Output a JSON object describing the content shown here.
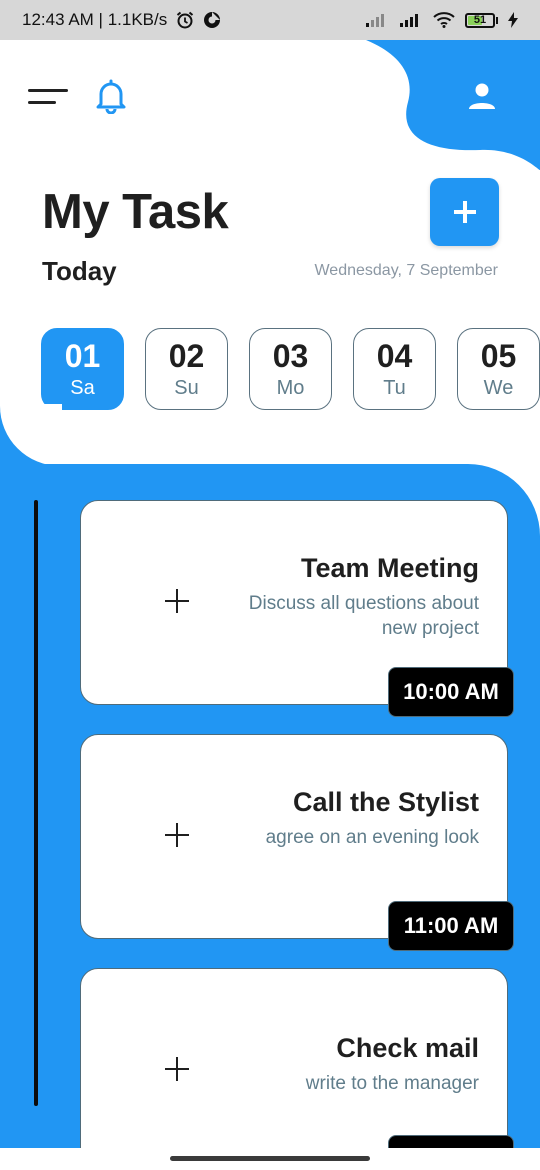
{
  "status_bar": {
    "time_speed": "12:43 AM | 1.1KB/s",
    "battery_level": "51",
    "icons": [
      "alarm-icon",
      "data-saver-icon",
      "signal-icon",
      "signal-icon",
      "wifi-icon",
      "battery-icon",
      "charging-icon"
    ]
  },
  "header": {
    "menu_icon": "hamburger-menu-icon",
    "bell_icon": "bell-icon",
    "profile_icon": "user-icon",
    "title": "My Task",
    "add_icon": "plus-icon",
    "today_label": "Today",
    "date": "Wednesday, 7 September"
  },
  "days": [
    {
      "num": "01",
      "dow": "Sa",
      "selected": true
    },
    {
      "num": "02",
      "dow": "Su",
      "selected": false
    },
    {
      "num": "03",
      "dow": "Mo",
      "selected": false
    },
    {
      "num": "04",
      "dow": "Tu",
      "selected": false
    },
    {
      "num": "05",
      "dow": "We",
      "selected": false
    }
  ],
  "tasks": [
    {
      "title": "Team Meeting",
      "desc": "Discuss all questions about new project",
      "time": "10:00 AM"
    },
    {
      "title": "Call the Stylist",
      "desc": "agree on an evening look",
      "time": "11:00 AM"
    },
    {
      "title": "Check mail",
      "desc": "write to the manager",
      "time": ""
    }
  ],
  "colors": {
    "accent": "#2196f3",
    "text_dark": "#1f1f1f",
    "text_muted": "#607d8b",
    "badge": "#000000"
  }
}
